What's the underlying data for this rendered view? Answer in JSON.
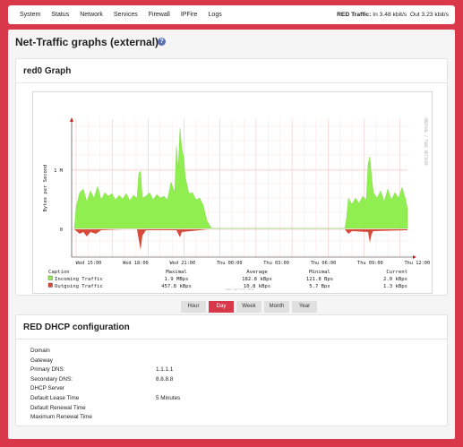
{
  "nav": {
    "items": [
      "System",
      "Status",
      "Network",
      "Services",
      "Firewall",
      "IPFire",
      "Logs"
    ],
    "red_label": "RED Traffic:",
    "red_in": "In 3.48 kbit/s",
    "red_out": "Out 3.23 kbit/s"
  },
  "page": {
    "title": "Net-Traffic graphs (external)",
    "help": "?"
  },
  "graph_box": {
    "title": "red0 Graph",
    "buttons": [
      {
        "label": "Hour",
        "active": false
      },
      {
        "label": "Day",
        "active": true
      },
      {
        "label": "Week",
        "active": false
      },
      {
        "label": "Month",
        "active": false
      },
      {
        "label": "Year",
        "active": false
      }
    ]
  },
  "chart_data": {
    "type": "area",
    "ylabel": "Bytes per Second",
    "side_label": "RRDTOOL / TOBI OETIKER",
    "watermark": "www.ipfire.org",
    "x_ticks": [
      "Wed 15:00",
      "Wed 18:00",
      "Wed 21:00",
      "Thu 00:00",
      "Thu 03:00",
      "Thu 06:00",
      "Thu 09:00",
      "Thu 12:00"
    ],
    "y_ticks": [
      "0",
      "1 M"
    ],
    "series": [
      {
        "name": "Incoming Traffic",
        "color": "#90ee50"
      },
      {
        "name": "Outgoing Traffic",
        "color": "#d84a3a"
      }
    ],
    "table": {
      "headers": [
        "Caption",
        "Maximal",
        "Average",
        "Minimal",
        "Current"
      ],
      "rows": [
        [
          "Incoming Traffic",
          "1.9 MBps",
          "182.8 kBps",
          "121.8  Bps",
          "2.0 kBps"
        ],
        [
          "Outgoing Traffic",
          "457.8 kBps",
          "10.8 kBps",
          "5.7  Bps",
          "1.3 kBps"
        ]
      ]
    }
  },
  "dhcp": {
    "title": "RED DHCP configuration",
    "rows": [
      {
        "key": "Domain",
        "value": ""
      },
      {
        "key": "Gateway",
        "value": ""
      },
      {
        "key": "Primary DNS:",
        "value": "1.1.1.1"
      },
      {
        "key": "Secondary DNS:",
        "value": "8.8.8.8"
      },
      {
        "key": "DHCP Server",
        "value": ""
      },
      {
        "key": "Default Lease Time",
        "value": "5 Minutes"
      },
      {
        "key": "Default Renewal Time",
        "value": ""
      },
      {
        "key": "Maximum Renewal Time",
        "value": ""
      }
    ]
  }
}
